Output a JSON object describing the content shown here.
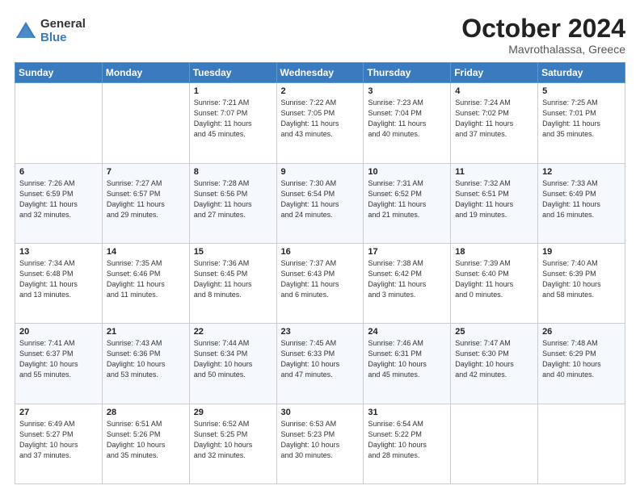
{
  "header": {
    "logo_general": "General",
    "logo_blue": "Blue",
    "month": "October 2024",
    "location": "Mavrothalassa, Greece"
  },
  "weekdays": [
    "Sunday",
    "Monday",
    "Tuesday",
    "Wednesday",
    "Thursday",
    "Friday",
    "Saturday"
  ],
  "weeks": [
    [
      {
        "day": "",
        "text": ""
      },
      {
        "day": "",
        "text": ""
      },
      {
        "day": "1",
        "text": "Sunrise: 7:21 AM\nSunset: 7:07 PM\nDaylight: 11 hours\nand 45 minutes."
      },
      {
        "day": "2",
        "text": "Sunrise: 7:22 AM\nSunset: 7:05 PM\nDaylight: 11 hours\nand 43 minutes."
      },
      {
        "day": "3",
        "text": "Sunrise: 7:23 AM\nSunset: 7:04 PM\nDaylight: 11 hours\nand 40 minutes."
      },
      {
        "day": "4",
        "text": "Sunrise: 7:24 AM\nSunset: 7:02 PM\nDaylight: 11 hours\nand 37 minutes."
      },
      {
        "day": "5",
        "text": "Sunrise: 7:25 AM\nSunset: 7:01 PM\nDaylight: 11 hours\nand 35 minutes."
      }
    ],
    [
      {
        "day": "6",
        "text": "Sunrise: 7:26 AM\nSunset: 6:59 PM\nDaylight: 11 hours\nand 32 minutes."
      },
      {
        "day": "7",
        "text": "Sunrise: 7:27 AM\nSunset: 6:57 PM\nDaylight: 11 hours\nand 29 minutes."
      },
      {
        "day": "8",
        "text": "Sunrise: 7:28 AM\nSunset: 6:56 PM\nDaylight: 11 hours\nand 27 minutes."
      },
      {
        "day": "9",
        "text": "Sunrise: 7:30 AM\nSunset: 6:54 PM\nDaylight: 11 hours\nand 24 minutes."
      },
      {
        "day": "10",
        "text": "Sunrise: 7:31 AM\nSunset: 6:52 PM\nDaylight: 11 hours\nand 21 minutes."
      },
      {
        "day": "11",
        "text": "Sunrise: 7:32 AM\nSunset: 6:51 PM\nDaylight: 11 hours\nand 19 minutes."
      },
      {
        "day": "12",
        "text": "Sunrise: 7:33 AM\nSunset: 6:49 PM\nDaylight: 11 hours\nand 16 minutes."
      }
    ],
    [
      {
        "day": "13",
        "text": "Sunrise: 7:34 AM\nSunset: 6:48 PM\nDaylight: 11 hours\nand 13 minutes."
      },
      {
        "day": "14",
        "text": "Sunrise: 7:35 AM\nSunset: 6:46 PM\nDaylight: 11 hours\nand 11 minutes."
      },
      {
        "day": "15",
        "text": "Sunrise: 7:36 AM\nSunset: 6:45 PM\nDaylight: 11 hours\nand 8 minutes."
      },
      {
        "day": "16",
        "text": "Sunrise: 7:37 AM\nSunset: 6:43 PM\nDaylight: 11 hours\nand 6 minutes."
      },
      {
        "day": "17",
        "text": "Sunrise: 7:38 AM\nSunset: 6:42 PM\nDaylight: 11 hours\nand 3 minutes."
      },
      {
        "day": "18",
        "text": "Sunrise: 7:39 AM\nSunset: 6:40 PM\nDaylight: 11 hours\nand 0 minutes."
      },
      {
        "day": "19",
        "text": "Sunrise: 7:40 AM\nSunset: 6:39 PM\nDaylight: 10 hours\nand 58 minutes."
      }
    ],
    [
      {
        "day": "20",
        "text": "Sunrise: 7:41 AM\nSunset: 6:37 PM\nDaylight: 10 hours\nand 55 minutes."
      },
      {
        "day": "21",
        "text": "Sunrise: 7:43 AM\nSunset: 6:36 PM\nDaylight: 10 hours\nand 53 minutes."
      },
      {
        "day": "22",
        "text": "Sunrise: 7:44 AM\nSunset: 6:34 PM\nDaylight: 10 hours\nand 50 minutes."
      },
      {
        "day": "23",
        "text": "Sunrise: 7:45 AM\nSunset: 6:33 PM\nDaylight: 10 hours\nand 47 minutes."
      },
      {
        "day": "24",
        "text": "Sunrise: 7:46 AM\nSunset: 6:31 PM\nDaylight: 10 hours\nand 45 minutes."
      },
      {
        "day": "25",
        "text": "Sunrise: 7:47 AM\nSunset: 6:30 PM\nDaylight: 10 hours\nand 42 minutes."
      },
      {
        "day": "26",
        "text": "Sunrise: 7:48 AM\nSunset: 6:29 PM\nDaylight: 10 hours\nand 40 minutes."
      }
    ],
    [
      {
        "day": "27",
        "text": "Sunrise: 6:49 AM\nSunset: 5:27 PM\nDaylight: 10 hours\nand 37 minutes."
      },
      {
        "day": "28",
        "text": "Sunrise: 6:51 AM\nSunset: 5:26 PM\nDaylight: 10 hours\nand 35 minutes."
      },
      {
        "day": "29",
        "text": "Sunrise: 6:52 AM\nSunset: 5:25 PM\nDaylight: 10 hours\nand 32 minutes."
      },
      {
        "day": "30",
        "text": "Sunrise: 6:53 AM\nSunset: 5:23 PM\nDaylight: 10 hours\nand 30 minutes."
      },
      {
        "day": "31",
        "text": "Sunrise: 6:54 AM\nSunset: 5:22 PM\nDaylight: 10 hours\nand 28 minutes."
      },
      {
        "day": "",
        "text": ""
      },
      {
        "day": "",
        "text": ""
      }
    ]
  ]
}
